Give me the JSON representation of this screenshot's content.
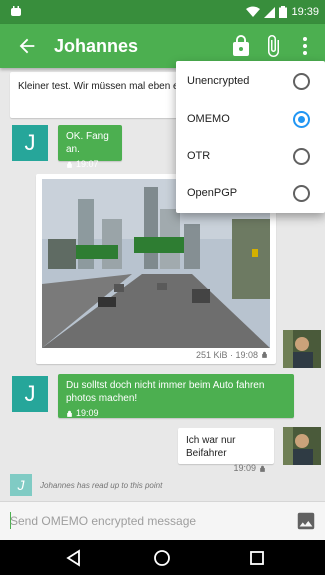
{
  "status_bar": {
    "time": "19:39"
  },
  "app_bar": {
    "title": "Johannes"
  },
  "messages": {
    "partial_incoming": "Kleiner test. Wir müssen mal eben ein machen.",
    "msg_ok": {
      "text": "OK. Fang an.",
      "time": "19:07"
    },
    "image_meta": "251 KiB · 19:08",
    "msg_photos": {
      "text": "Du solltst doch nicht immer beim Auto fahren photos machen!",
      "time": "19:09"
    },
    "msg_beifahrer": {
      "text": "Ich war nur Beifahrer",
      "time": "19:09"
    },
    "avatar_letter": "J",
    "read_marker": "Johannes has read up to this point"
  },
  "encryption_menu": {
    "items": [
      {
        "label": "Unencrypted",
        "selected": false
      },
      {
        "label": "OMEMO",
        "selected": true
      },
      {
        "label": "OTR",
        "selected": false
      },
      {
        "label": "OpenPGP",
        "selected": false
      }
    ]
  },
  "composer": {
    "placeholder": "Send OMEMO encrypted message"
  },
  "colors": {
    "primary": "#4caf50",
    "primary_dark": "#388e3c",
    "accent": "#2196f3",
    "avatar": "#26a69a"
  }
}
